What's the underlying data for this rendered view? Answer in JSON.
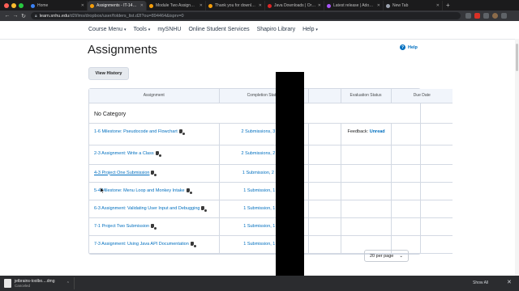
{
  "browser": {
    "tabs": [
      {
        "title": "Home",
        "active": false,
        "color": "#3b82f6"
      },
      {
        "title": "Assignments - IT-145-J3...",
        "active": true,
        "color": "#f59e0b"
      },
      {
        "title": "Module Two Assignment Gu...",
        "active": false,
        "color": "#f59e0b"
      },
      {
        "title": "Thank you for downloading...",
        "active": false,
        "color": "#f59e0b"
      },
      {
        "title": "Java Downloads | Oracle",
        "active": false,
        "color": "#dc2626"
      },
      {
        "title": "Latest release | Adoptium",
        "active": false,
        "color": "#a855f7"
      },
      {
        "title": "New Tab",
        "active": false,
        "color": "#9ca3af"
      }
    ],
    "url": {
      "host": "learn.snhu.edu",
      "path": "/d2l/lms/dropbox/user/folders_list.d2l?ou=894464&isprv=0"
    }
  },
  "nav": {
    "items": [
      "Course Menu",
      "Tools",
      "mySNHU",
      "Online Student Services",
      "Shapiro Library",
      "Help"
    ]
  },
  "page": {
    "title": "Assignments",
    "help_label": "Help",
    "view_history_label": "View History"
  },
  "table": {
    "headers": [
      "Assignment",
      "Completion Status",
      "",
      "Evaluation Status",
      "Due Date"
    ],
    "category": "No Category",
    "rows": [
      {
        "name": "1-6 Milestone: Pseudocode and Flowchart",
        "status": "2 Submissions, 3 Files",
        "feedback_label": "Feedback:",
        "feedback_value": "Unread"
      },
      {
        "name": "2-3 Assignment: Write a Class",
        "status": "2 Submissions, 2 Files",
        "feedback_label": "",
        "feedback_value": ""
      },
      {
        "name": "4-3 Project One Submission",
        "status": "1 Submission, 2 Files",
        "feedback_label": "",
        "feedback_value": ""
      },
      {
        "name": "5-4 Milestone: Menu Loop and Monkey Intake",
        "status": "1 Submission, 1 File",
        "feedback_label": "",
        "feedback_value": ""
      },
      {
        "name": "6-3 Assignment: Validating User Input and Debugging",
        "status": "1 Submission, 1 File",
        "feedback_label": "",
        "feedback_value": ""
      },
      {
        "name": "7-1 Project Two Submission",
        "status": "1 Submission, 1 File",
        "feedback_label": "",
        "feedback_value": ""
      },
      {
        "name": "7-3 Assignment: Using Java API Documentation",
        "status": "1 Submission, 1 File",
        "feedback_label": "",
        "feedback_value": ""
      }
    ]
  },
  "pagination": {
    "per_page": "20 per page"
  },
  "downloads": {
    "file": "jetbrains-toolbo....dmg",
    "status": "Canceled",
    "show_all": "Show All"
  },
  "colors": {
    "link": "#006fbf",
    "header_bg": "#f1f5fb",
    "border": "#d3d9e3"
  }
}
